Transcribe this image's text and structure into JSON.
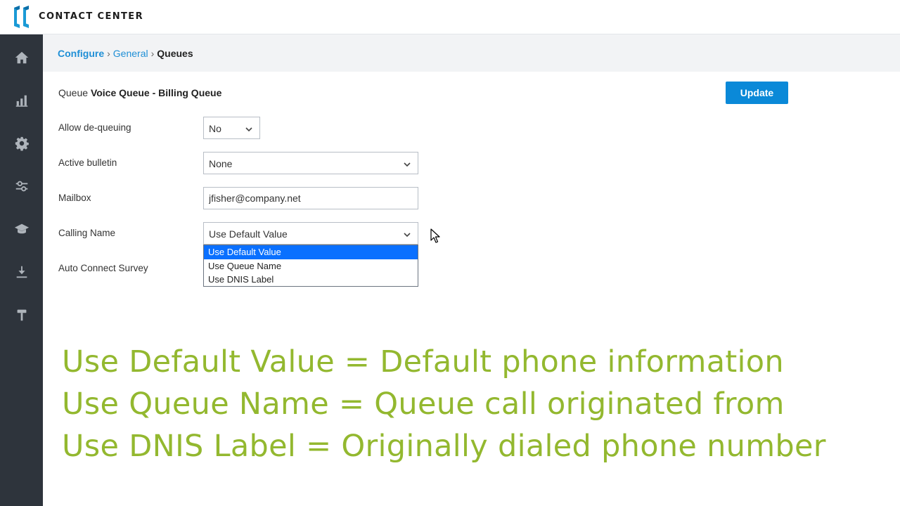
{
  "app": {
    "brand": "CONTACT CENTER",
    "colors": {
      "accent": "#0a89d8",
      "sidebar": "#2e343c",
      "caption": "#93b82f",
      "link": "#1f8fd6"
    }
  },
  "sidebar": {
    "items": [
      {
        "name": "home",
        "icon": "home-icon"
      },
      {
        "name": "reports",
        "icon": "bar-chart-icon"
      },
      {
        "name": "configure",
        "icon": "gear-icon"
      },
      {
        "name": "settings",
        "icon": "sliders-icon"
      },
      {
        "name": "training",
        "icon": "graduation-cap-icon"
      },
      {
        "name": "downloads",
        "icon": "download-icon"
      },
      {
        "name": "tools",
        "icon": "hammer-icon"
      }
    ]
  },
  "breadcrumb": {
    "items": [
      "Configure",
      "General"
    ],
    "separator": "›",
    "current": "Queues"
  },
  "queue": {
    "prefix": "Queue",
    "name": "Voice Queue - Billing Queue"
  },
  "toolbar": {
    "update_label": "Update"
  },
  "form": {
    "allow_dequeuing": {
      "label": "Allow de-queuing",
      "value": "No"
    },
    "active_bulletin": {
      "label": "Active bulletin",
      "value": "None"
    },
    "mailbox": {
      "label": "Mailbox",
      "value": "jfisher@company.net"
    },
    "calling_name": {
      "label": "Calling Name",
      "value": "Use Default Value",
      "options": [
        "Use Default Value",
        "Use Queue Name",
        "Use DNIS Label"
      ],
      "selected_index": 0
    },
    "auto_connect_survey": {
      "label": "Auto Connect Survey"
    }
  },
  "captions": [
    "Use Default Value = Default phone information",
    "Use Queue Name = Queue call originated from",
    "Use DNIS Label = Originally dialed phone number"
  ]
}
